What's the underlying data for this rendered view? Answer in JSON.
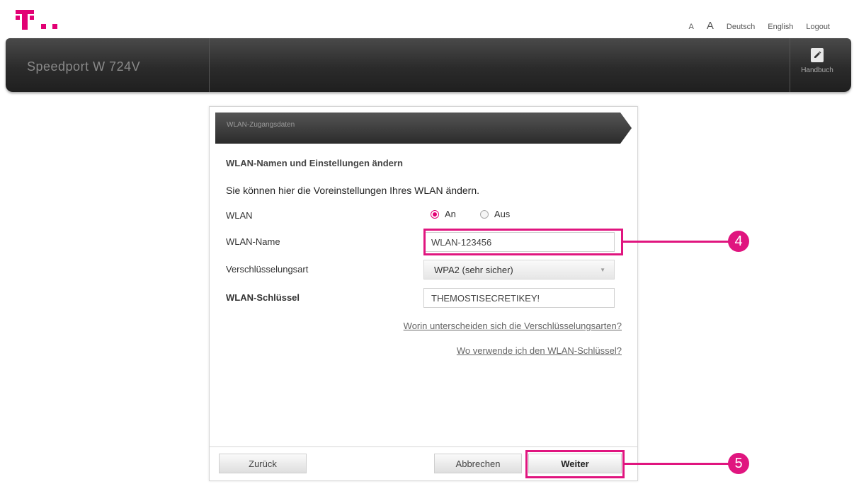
{
  "brand": {
    "color": "#e20074"
  },
  "toplinks": {
    "font_small": "A",
    "font_large": "A",
    "deutsch": "Deutsch",
    "english": "English",
    "logout": "Logout"
  },
  "header": {
    "product": "Speedport W 724V",
    "handbook": "Handbuch",
    "handbook_icon": "book-edit-icon"
  },
  "panel": {
    "title": "WLAN-Zugangsdaten",
    "section_title": "WLAN-Namen und Einstellungen ändern",
    "intro": "Sie können hier die Voreinstellungen Ihres WLAN ändern.",
    "wlan_label": "WLAN",
    "radio_on": "An",
    "radio_off": "Aus",
    "radio_selected": "An",
    "name_label": "WLAN-Name",
    "name_value": "WLAN-123456",
    "encryption_label": "Verschlüsselungsart",
    "encryption_value": "WPA2 (sehr sicher)",
    "key_label": "WLAN-Schlüssel",
    "key_value": "THEMOSTISECRETIKEY!",
    "link_encryption": "Worin unterscheiden sich die Verschlüsselungsarten?",
    "link_key": "Wo verwende ich den WLAN-Schlüssel?"
  },
  "buttons": {
    "back": "Zurück",
    "cancel": "Abbrechen",
    "next": "Weiter"
  },
  "callouts": {
    "name_marker": "4",
    "next_marker": "5",
    "color": "#e0157f"
  }
}
